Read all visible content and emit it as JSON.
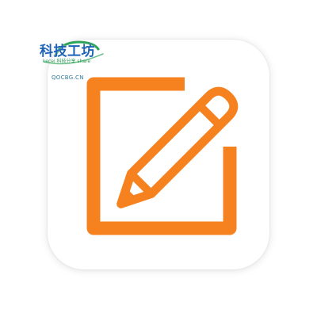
{
  "icon": {
    "name": "note-edit-icon",
    "accent_color": "#f5821f",
    "tile_color": "#ffffff"
  },
  "watermark": {
    "title": "科技工坊",
    "subtitle": "kecei 科技分享 share",
    "domain": "QOCBG.CN",
    "title_color": "#1f63b8",
    "swoosh_color": "#2fa55a"
  }
}
